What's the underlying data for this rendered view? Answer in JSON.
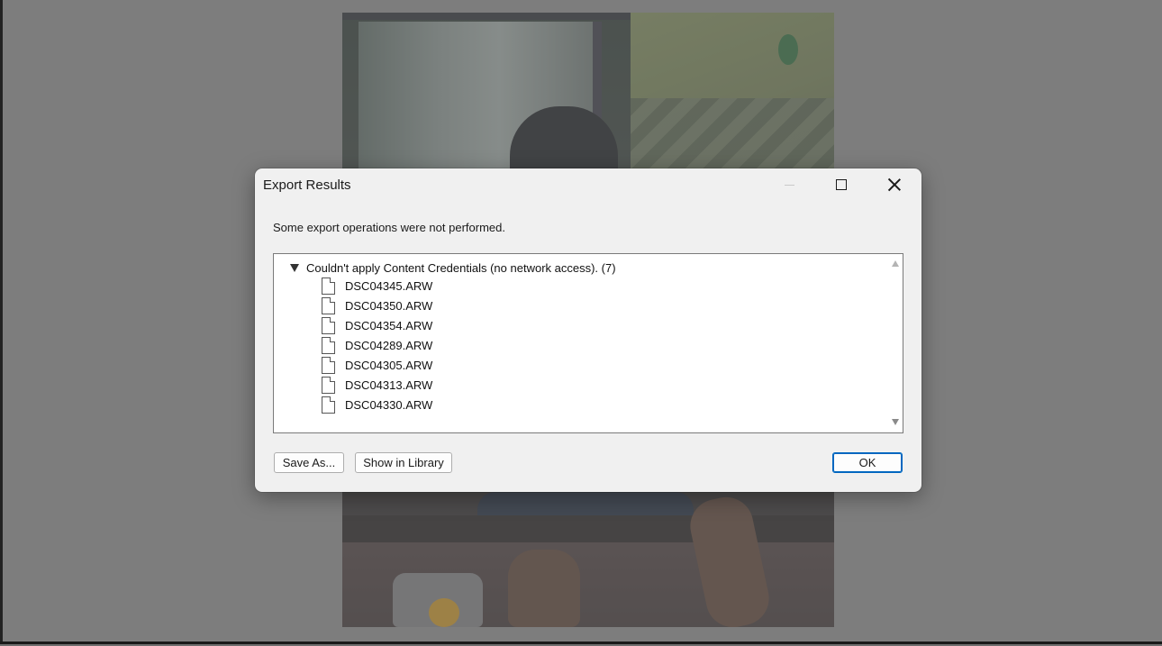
{
  "dialog": {
    "title": "Export Results",
    "message": "Some export operations were not performed.",
    "window_controls": {
      "minimize_icon": "minimize-icon",
      "maximize_icon": "maximize-icon",
      "close_icon": "close-icon"
    },
    "results": {
      "group_label": "Couldn't apply Content Credentials (no network access). (7)",
      "expanded": true,
      "files": [
        "DSC04345.ARW",
        "DSC04350.ARW",
        "DSC04354.ARW",
        "DSC04289.ARW",
        "DSC04305.ARW",
        "DSC04313.ARW",
        "DSC04330.ARW"
      ]
    },
    "buttons": {
      "save_as": "Save As...",
      "show_in_library": "Show in Library",
      "ok": "OK"
    }
  },
  "colors": {
    "overlay": "#7d7d7d",
    "dialog_bg": "#f0f0f0",
    "default_button_border": "#0067c0"
  }
}
